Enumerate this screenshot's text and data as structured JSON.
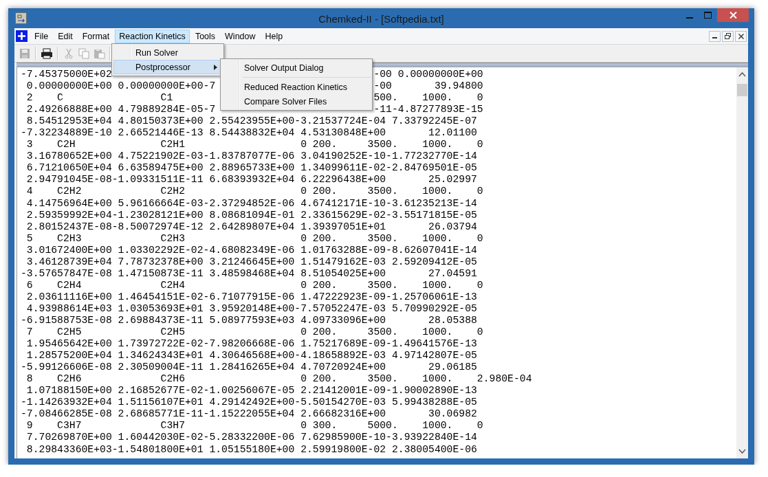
{
  "window": {
    "title": "Chemked-II - [Softpedia.txt]"
  },
  "menu_bar": [
    {
      "label": "File",
      "selected": false
    },
    {
      "label": "Edit",
      "selected": false
    },
    {
      "label": "Format",
      "selected": false
    },
    {
      "label": "Reaction Kinetics",
      "selected": true
    },
    {
      "label": "Tools",
      "selected": false
    },
    {
      "label": "Window",
      "selected": false
    },
    {
      "label": "Help",
      "selected": false
    }
  ],
  "toolbar": [
    {
      "kind": "save",
      "disabled": true
    },
    {
      "kind": "separator"
    },
    {
      "kind": "print",
      "disabled": false
    },
    {
      "kind": "separator"
    },
    {
      "kind": "cut",
      "disabled": true
    },
    {
      "kind": "copy",
      "disabled": true
    },
    {
      "kind": "paste",
      "disabled": true
    },
    {
      "kind": "separator"
    }
  ],
  "menu": {
    "items": [
      {
        "label": "Run Solver",
        "selected": false,
        "submenu": false
      },
      {
        "label": "Postprocessor",
        "selected": true,
        "submenu": true
      }
    ]
  },
  "submenu": {
    "items": [
      {
        "kind": "item",
        "label": "Solver Output Dialog"
      },
      {
        "kind": "separator"
      },
      {
        "kind": "item",
        "label": "Reduced Reaction Kinetics"
      },
      {
        "kind": "item",
        "label": "Compare Solver Files"
      }
    ]
  },
  "document": {
    "lines": [
      {
        "kind": "covered",
        "left": "-7.45375000E+02",
        "right": "-00 0.00000000E+00"
      },
      {
        "kind": "covered",
        "left": " 0.00000000E+00 0.00000000E+00-7",
        "right": "-00       39.94800"
      },
      {
        "kind": "covered",
        "left": " 2    C                C1",
        "right": "500.    1000.    0"
      },
      {
        "kind": "covered",
        "left": " 2.49266888E+00 4.79889284E-05-7",
        "right": "-11-4.87277893E-15"
      },
      {
        "kind": "full",
        "text": " 8.54512953E+04 4.80150373E+00 2.55423955E+00-3.21537724E-04 7.33792245E-07"
      },
      {
        "kind": "full",
        "text": "-7.32234889E-10 2.66521446E-13 8.54438832E+04 4.53130848E+00       12.01100"
      },
      {
        "kind": "full",
        "text": " 3    C2H              C2H1                   0 200.     3500.    1000.    0"
      },
      {
        "kind": "full",
        "text": " 3.16780652E+00 4.75221902E-03-1.83787077E-06 3.04190252E-10-1.77232770E-14"
      },
      {
        "kind": "full",
        "text": " 6.71210650E+04 6.63589475E+00 2.88965733E+00 1.34099611E-02-2.84769501E-05"
      },
      {
        "kind": "full",
        "text": " 2.94791045E-08-1.09331511E-11 6.68393932E+04 6.22296438E+00       25.02997"
      },
      {
        "kind": "full",
        "text": " 4    C2H2             C2H2                   0 200.     3500.    1000.    0"
      },
      {
        "kind": "full",
        "text": " 4.14756964E+00 5.96166664E-03-2.37294852E-06 4.67412171E-10-3.61235213E-14"
      },
      {
        "kind": "full",
        "text": " 2.59359992E+04-1.23028121E+00 8.08681094E-01 2.33615629E-02-3.55171815E-05"
      },
      {
        "kind": "full",
        "text": " 2.80152437E-08-8.50072974E-12 2.64289807E+04 1.39397051E+01       26.03794"
      },
      {
        "kind": "full",
        "text": " 5    C2H3             C2H3                   0 200.     3500.    1000.    0"
      },
      {
        "kind": "full",
        "text": " 3.01672400E+00 1.03302292E-02-4.68082349E-06 1.01763288E-09-8.62607041E-14"
      },
      {
        "kind": "full",
        "text": " 3.46128739E+04 7.78732378E+00 3.21246645E+00 1.51479162E-03 2.59209412E-05"
      },
      {
        "kind": "full",
        "text": "-3.57657847E-08 1.47150873E-11 3.48598468E+04 8.51054025E+00       27.04591"
      },
      {
        "kind": "full",
        "text": " 6    C2H4             C2H4                   0 200.     3500.    1000.    0"
      },
      {
        "kind": "full",
        "text": " 2.03611116E+00 1.46454151E-02-6.71077915E-06 1.47222923E-09-1.25706061E-13"
      },
      {
        "kind": "full",
        "text": " 4.93988614E+03 1.03053693E+01 3.95920148E+00-7.57052247E-03 5.70990292E-05"
      },
      {
        "kind": "full",
        "text": "-6.91588753E-08 2.69884373E-11 5.08977593E+03 4.09733096E+00       28.05388"
      },
      {
        "kind": "full",
        "text": " 7    C2H5             C2H5                   0 200.     3500.    1000.    0"
      },
      {
        "kind": "full",
        "text": " 1.95465642E+00 1.73972722E-02-7.98206668E-06 1.75217689E-09-1.49641576E-13"
      },
      {
        "kind": "full",
        "text": " 1.28575200E+04 1.34624343E+01 4.30646568E+00-4.18658892E-03 4.97142807E-05"
      },
      {
        "kind": "full",
        "text": "-5.99126606E-08 2.30509004E-11 1.28416265E+04 4.70720924E+00       29.06185"
      },
      {
        "kind": "full",
        "text": " 8    C2H6             C2H6                   0 200.     3500.    1000.    2.980E-04"
      },
      {
        "kind": "full",
        "text": " 1.07188150E+00 2.16852677E-02-1.00256067E-05 2.21412001E-09-1.90002890E-13"
      },
      {
        "kind": "full",
        "text": "-1.14263932E+04 1.51156107E+01 4.29142492E+00-5.50154270E-03 5.99438288E-05"
      },
      {
        "kind": "full",
        "text": "-7.08466285E-08 2.68685771E-11-1.15222055E+04 2.66682316E+00       30.06982"
      },
      {
        "kind": "full",
        "text": " 9    C3H7             C3H7                   0 300.     5000.    1000.    0"
      },
      {
        "kind": "full",
        "text": " 7.70269870E+00 1.60442030E-02-5.28332200E-06 7.62985900E-10-3.93922840E-14"
      },
      {
        "kind": "full",
        "text": " 8.29843360E+03-1.54801800E+01 1.05155180E+00 2.59919800E-02 2.38005400E-06"
      }
    ]
  }
}
